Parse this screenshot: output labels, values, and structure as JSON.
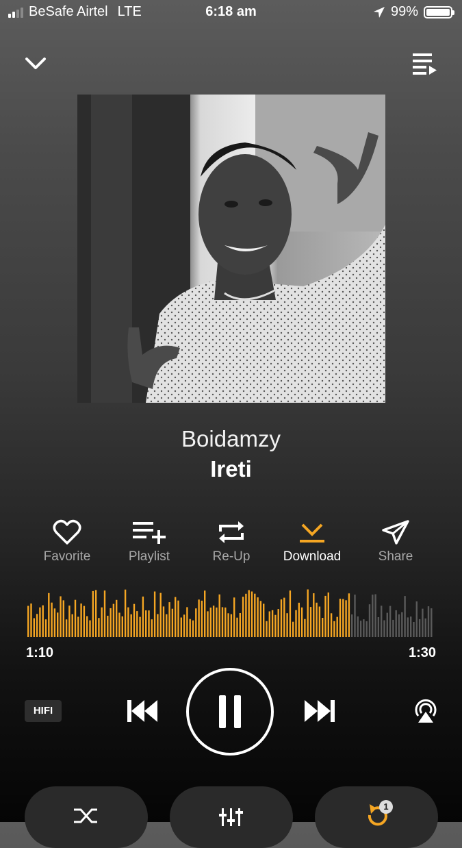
{
  "status": {
    "carrier": "BeSafe Airtel",
    "network": "LTE",
    "time": "6:18 am",
    "battery": "99%"
  },
  "track": {
    "artist": "Boidamzy",
    "title": "Ireti"
  },
  "actions": {
    "favorite": "Favorite",
    "playlist": "Playlist",
    "reup": "Re-Up",
    "download": "Download",
    "share": "Share"
  },
  "progress": {
    "elapsed": "1:10",
    "remaining": "1:30",
    "played_fraction": 0.79
  },
  "controls": {
    "hifi": "HIFI",
    "repeat_badge": "1"
  },
  "colors": {
    "accent": "#f5a623",
    "unplayed": "#5a5a5a"
  }
}
